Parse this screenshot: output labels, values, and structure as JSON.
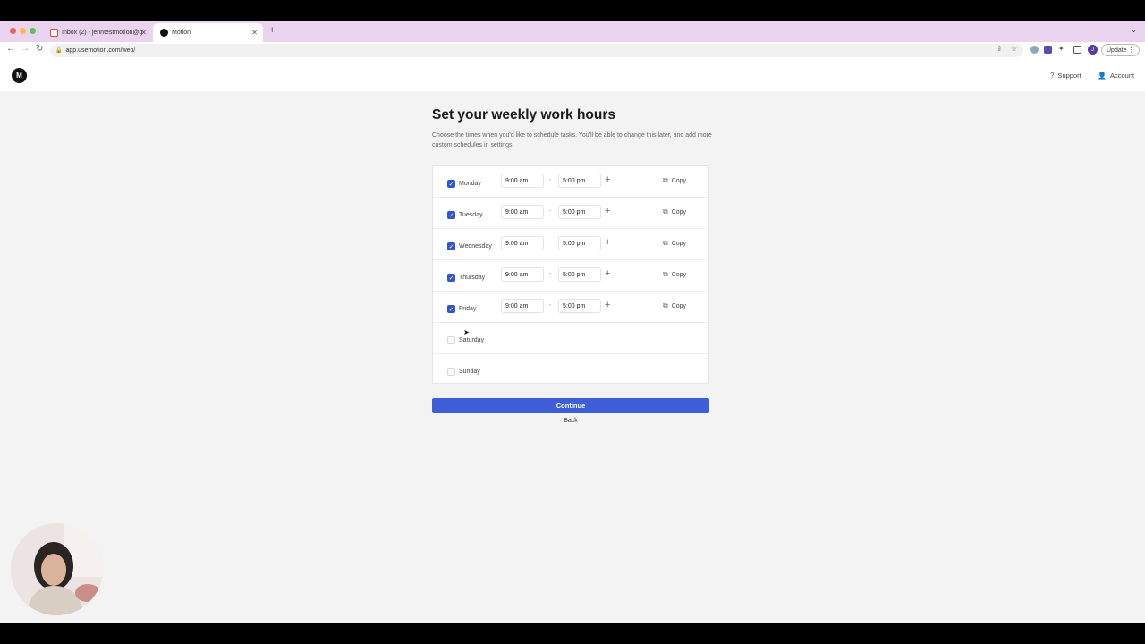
{
  "browser": {
    "tabs": [
      {
        "label": "Inbox (2) - jenntestmotion@g",
        "active": false
      },
      {
        "label": "Motion",
        "active": true
      }
    ],
    "url": "app.usemotion.com/web/",
    "update_label": "Update",
    "profile_initial": "J"
  },
  "header": {
    "logo_text": "M",
    "support_label": "Support",
    "account_label": "Account"
  },
  "main": {
    "title": "Set your weekly work hours",
    "subtitle": "Choose the times when you'd like to schedule tasks. You'll be able to change this later, and add more custom schedules in settings.",
    "days": [
      {
        "name": "Monday",
        "checked": true,
        "start": "9:00 am",
        "end": "5:00 pm",
        "copy_label": "Copy"
      },
      {
        "name": "Tuesday",
        "checked": true,
        "start": "9:00 am",
        "end": "5:00 pm",
        "copy_label": "Copy"
      },
      {
        "name": "Wednesday",
        "checked": true,
        "start": "9:00 am",
        "end": "5:00 pm",
        "copy_label": "Copy"
      },
      {
        "name": "Thursday",
        "checked": true,
        "start": "9:00 am",
        "end": "5:00 pm",
        "copy_label": "Copy"
      },
      {
        "name": "Friday",
        "checked": true,
        "start": "9:00 am",
        "end": "5:00 pm",
        "copy_label": "Copy"
      },
      {
        "name": "Saturday",
        "checked": false
      },
      {
        "name": "Sunday",
        "checked": false
      }
    ],
    "continue_label": "Continue",
    "back_label": "Back"
  },
  "colors": {
    "accent": "#3d5ed6",
    "checkbox": "#2f57c9",
    "tabstrip": "#ead3ee"
  }
}
